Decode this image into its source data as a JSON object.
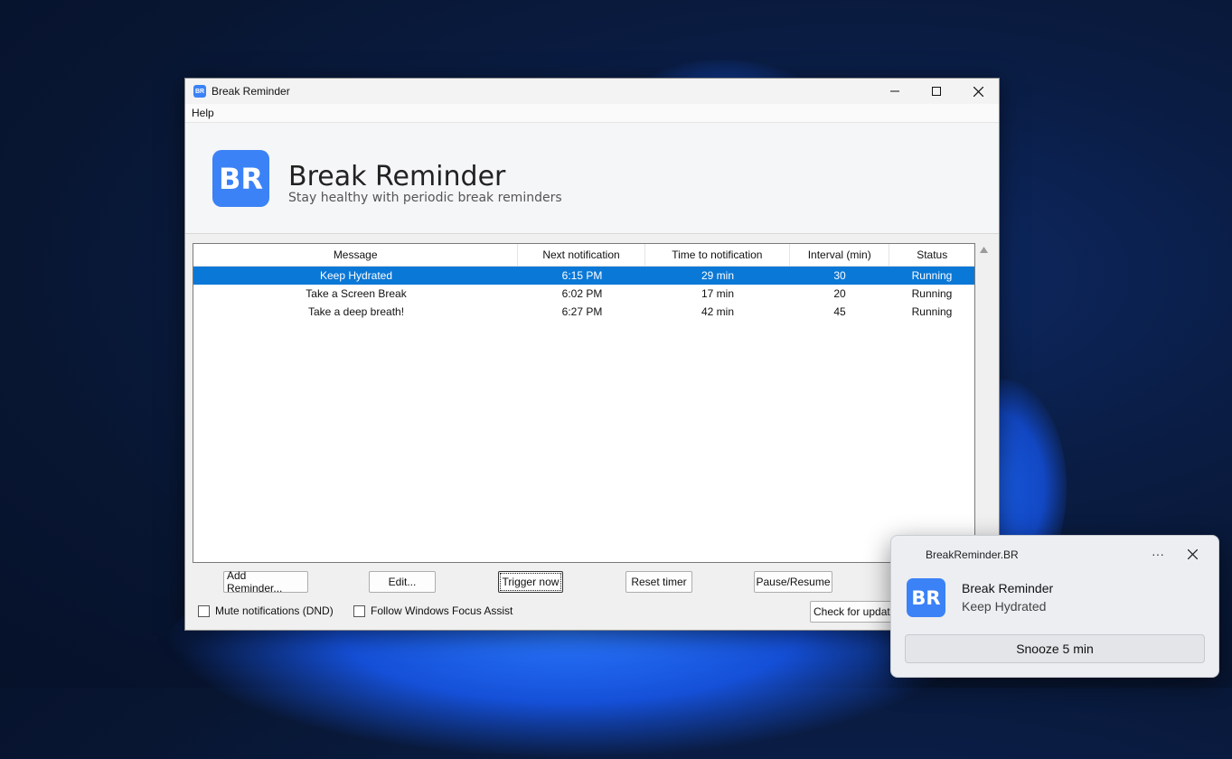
{
  "window": {
    "title": "Break Reminder",
    "menu": [
      "Help"
    ]
  },
  "header": {
    "logo_text": "BR",
    "app_name": "Break Reminder",
    "tagline": "Stay healthy with periodic break reminders"
  },
  "table": {
    "columns": [
      "Message",
      "Next notification",
      "Time to notification",
      "Interval (min)",
      "Status"
    ],
    "rows": [
      [
        "Keep Hydrated",
        "6:15 PM",
        "29 min",
        "30",
        "Running"
      ],
      [
        "Take a Screen Break",
        "6:02 PM",
        "17 min",
        "20",
        "Running"
      ],
      [
        "Take a deep breath!",
        "6:27 PM",
        "42 min",
        "45",
        "Running"
      ]
    ],
    "selected_row": 0
  },
  "buttons": {
    "add": "Add Reminder...",
    "edit": "Edit...",
    "trigger": "Trigger now",
    "reset": "Reset timer",
    "pause": "Pause/Resume",
    "updates": "Check for update"
  },
  "checkboxes": {
    "mute": "Mute notifications (DND)",
    "focus_assist": "Follow Windows Focus Assist"
  },
  "toast": {
    "source": "BreakReminder.BR",
    "more": "···",
    "icon_text": "BR",
    "title": "Break Reminder",
    "message": "Keep Hydrated",
    "action": "Snooze 5 min"
  },
  "colors": {
    "accent": "#3b82f6",
    "selection": "#0a78d7"
  }
}
